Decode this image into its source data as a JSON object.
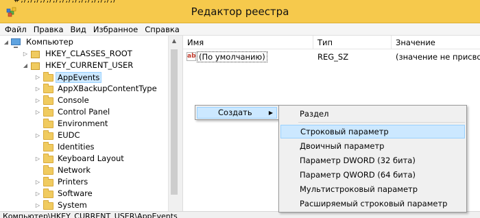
{
  "window": {
    "title": "Редактор реестра",
    "top_clipped_text": "#;/;/,/;/,/,/;/,/;/,/;/,/;/,/;/"
  },
  "menu": [
    "Файл",
    "Правка",
    "Вид",
    "Избранное",
    "Справка"
  ],
  "tree": {
    "root": "Компьютер",
    "hkcr": "HKEY_CLASSES_ROOT",
    "hkcu": "HKEY_CURRENT_USER",
    "children": [
      "AppEvents",
      "AppXBackupContentType",
      "Console",
      "Control Panel",
      "Environment",
      "EUDC",
      "Identities",
      "Keyboard Layout",
      "Network",
      "Printers",
      "Software",
      "System"
    ],
    "selected": "AppEvents"
  },
  "list": {
    "columns": [
      "Имя",
      "Тип",
      "Значение"
    ],
    "rows": [
      {
        "name": "(По умолчанию)",
        "type": "REG_SZ",
        "value": "(значение не присвоен"
      }
    ],
    "value_icon": "ab-string-icon"
  },
  "context_menu": {
    "item": "Создать",
    "arrow": "▶"
  },
  "submenu": {
    "items": [
      "Раздел",
      "Строковый параметр",
      "Двоичный параметр",
      "Параметр DWORD (32 бита)",
      "Параметр QWORD (64 бита)",
      "Мультистроковый параметр",
      "Расширяемый строковый параметр"
    ],
    "highlighted": "Строковый параметр"
  },
  "statusbar": {
    "text": "Компьютер\\HKEY_CURRENT_USER\\AppEvents"
  },
  "icons": {
    "app": "registry-editor-icon",
    "folder": "folder-icon",
    "computer": "computer-icon"
  },
  "colors": {
    "titlebar": "#f6c94c",
    "selection": "#cce8ff",
    "selection_border": "#99d1ff"
  }
}
